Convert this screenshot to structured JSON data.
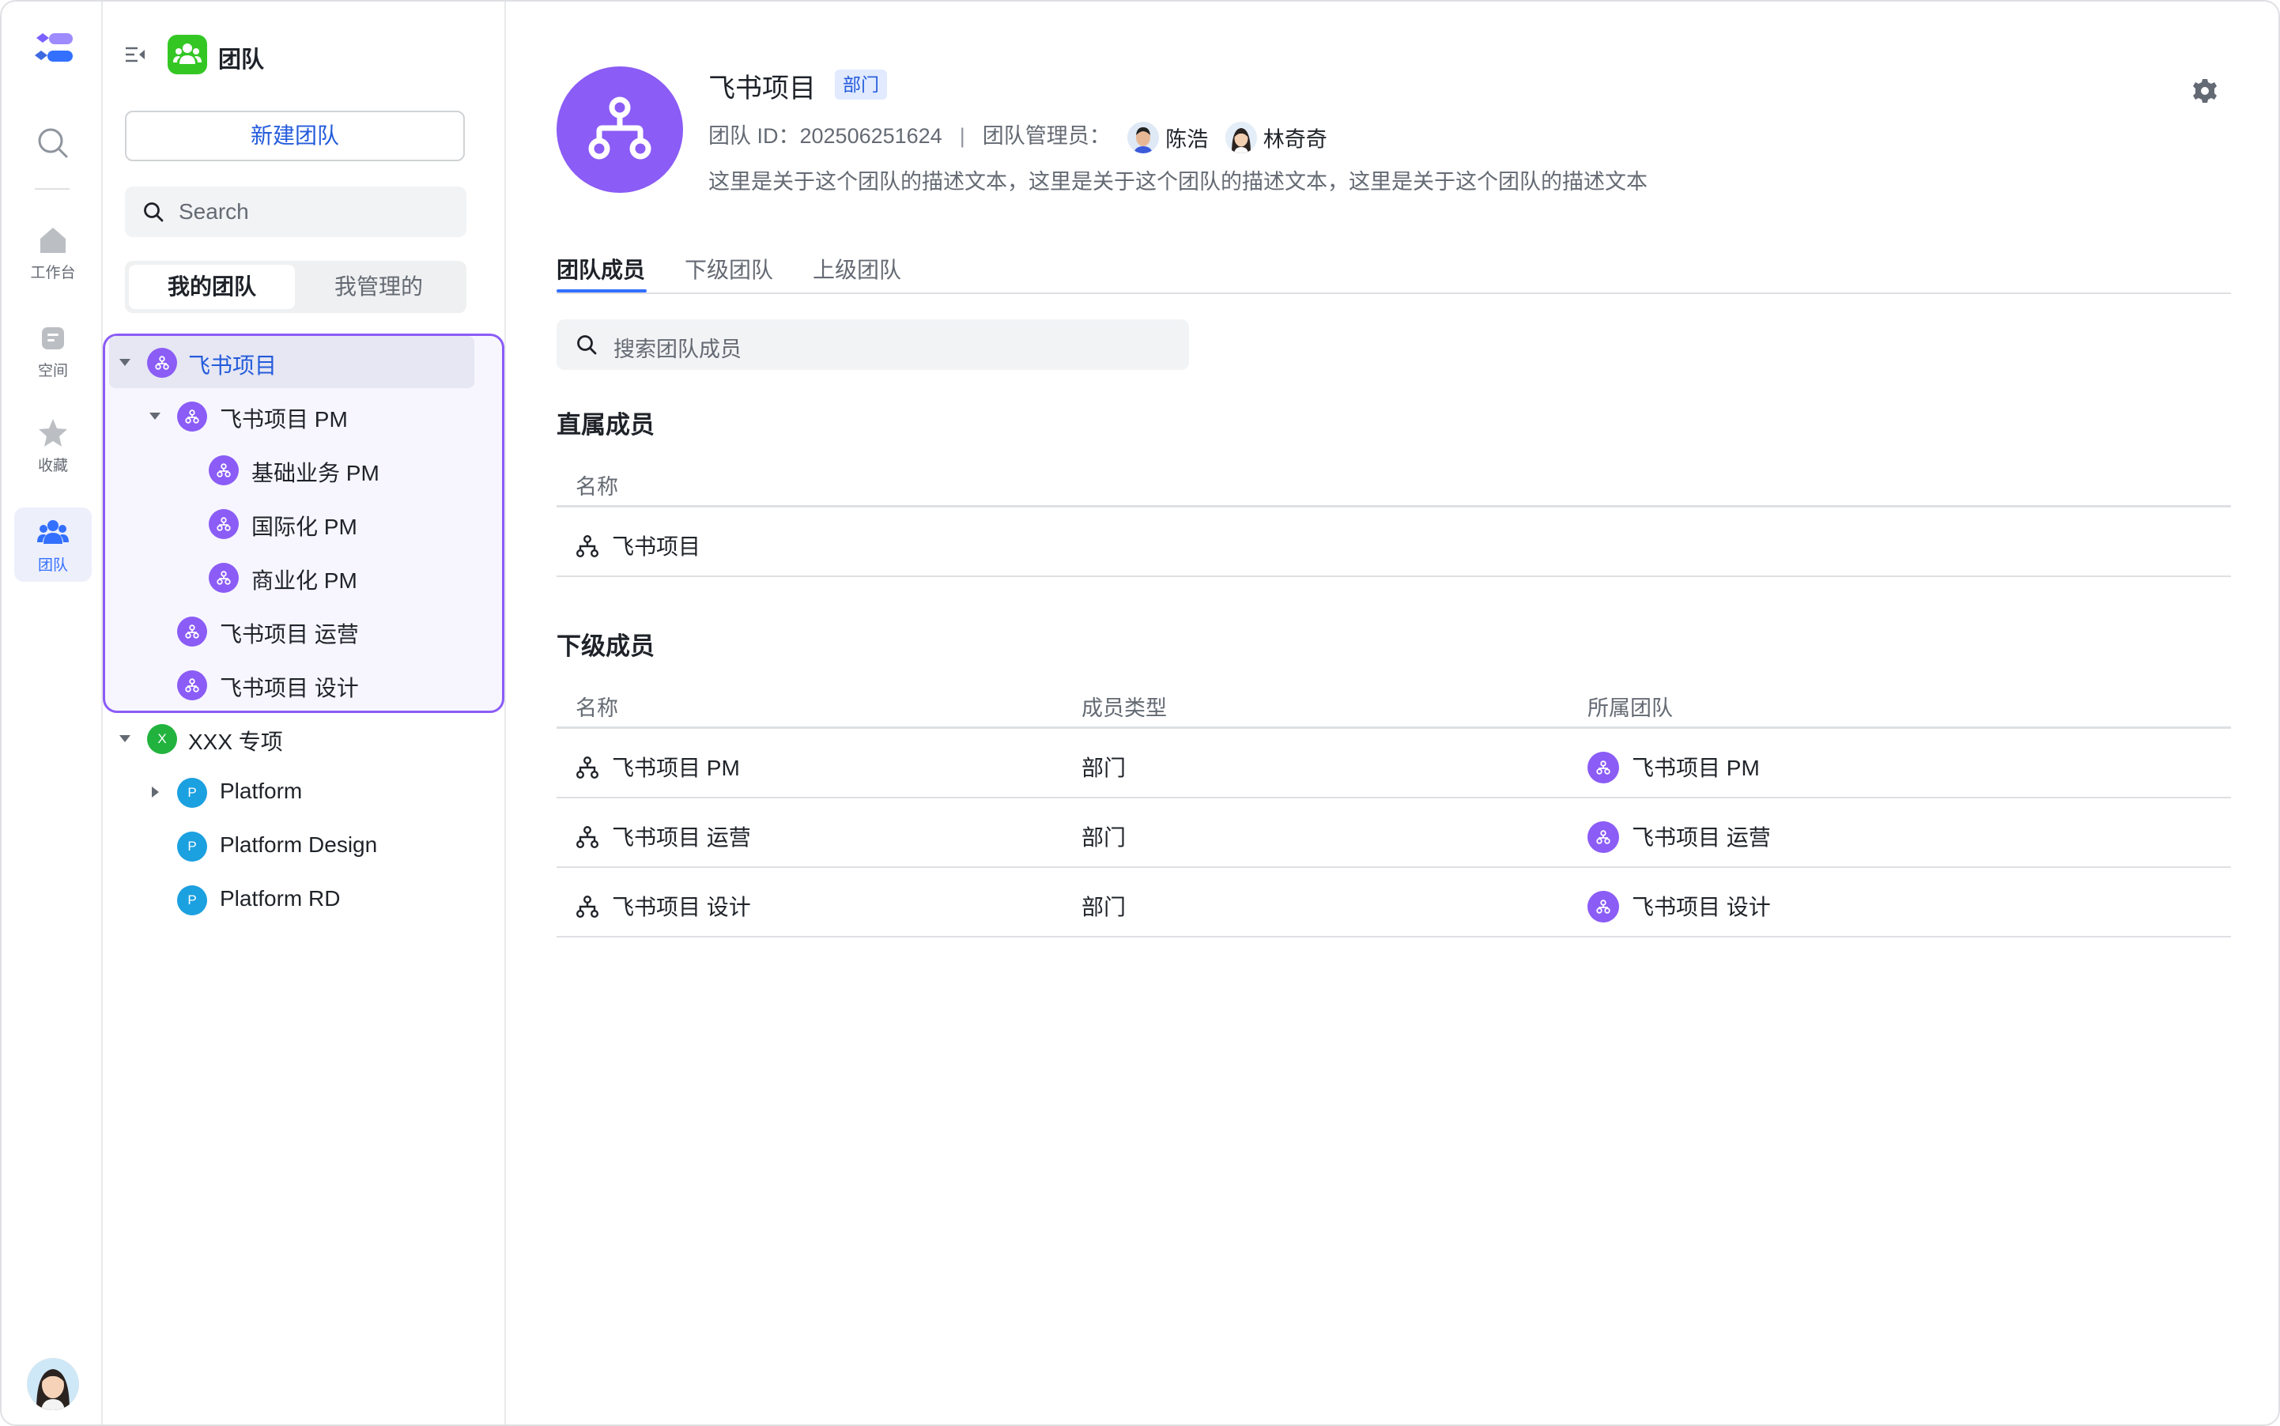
{
  "rail": {
    "items": [
      {
        "label": "工作台",
        "icon": "home-icon"
      },
      {
        "label": "空间",
        "icon": "space-icon"
      },
      {
        "label": "收藏",
        "icon": "star-icon"
      },
      {
        "label": "团队",
        "icon": "team-icon",
        "active": true
      }
    ]
  },
  "panel": {
    "app_title": "团队",
    "new_team_label": "新建团队",
    "search_placeholder": "Search",
    "segments": {
      "mine": "我的团队",
      "managed": "我管理的"
    },
    "tree": [
      {
        "label": "飞书项目",
        "level": 0,
        "expanded": true,
        "selected": true,
        "badge": "org",
        "color": "#8b5cf6"
      },
      {
        "label": "飞书项目 PM",
        "level": 1,
        "expanded": true,
        "badge": "org",
        "color": "#8b5cf6"
      },
      {
        "label": "基础业务 PM",
        "level": 2,
        "badge": "org",
        "color": "#8b5cf6"
      },
      {
        "label": "国际化 PM",
        "level": 2,
        "badge": "org",
        "color": "#8b5cf6"
      },
      {
        "label": "商业化 PM",
        "level": 2,
        "badge": "org",
        "color": "#8b5cf6"
      },
      {
        "label": "飞书项目 运营",
        "level": 1,
        "badge": "org",
        "color": "#8b5cf6"
      },
      {
        "label": "飞书项目 设计",
        "level": 1,
        "badge": "org",
        "color": "#8b5cf6"
      },
      {
        "label": "XXX 专项",
        "level": 0,
        "expanded": true,
        "badge": "X",
        "color": "#21b33e"
      },
      {
        "label": "Platform",
        "level": 1,
        "collapsed": true,
        "badge": "P",
        "color": "#1ba0e0"
      },
      {
        "label": "Platform Design",
        "level": 1,
        "badge": "P",
        "color": "#1ba0e0"
      },
      {
        "label": "Platform RD",
        "level": 1,
        "badge": "P",
        "color": "#1ba0e0"
      }
    ]
  },
  "header": {
    "team_name": "飞书项目",
    "type_tag": "部门",
    "id_text": "团队 ID：202506251624",
    "pipe": "|",
    "managers_label": "团队管理员：",
    "managers": [
      "陈浩",
      "林奇奇"
    ],
    "description": "这里是关于这个团队的描述文本，这里是关于这个团队的描述文本，这里是关于这个团队的描述文本"
  },
  "tabs": [
    "团队成员",
    "下级团队",
    "上级团队"
  ],
  "member_search_placeholder": "搜索团队成员",
  "direct": {
    "title": "直属成员",
    "col_name": "名称",
    "rows": [
      {
        "name": "飞书项目"
      }
    ]
  },
  "sub": {
    "title": "下级成员",
    "cols": [
      "名称",
      "成员类型",
      "所属团队"
    ],
    "rows": [
      {
        "name": "飞书项目 PM",
        "type": "部门",
        "team": "飞书项目 PM"
      },
      {
        "name": "飞书项目 运营",
        "type": "部门",
        "team": "飞书项目 运营"
      },
      {
        "name": "飞书项目 设计",
        "type": "部门",
        "team": "飞书项目 设计"
      }
    ]
  },
  "colors": {
    "accent": "#3370ff",
    "brand_purple": "#8b5cf6",
    "app_green": "#34c724"
  }
}
